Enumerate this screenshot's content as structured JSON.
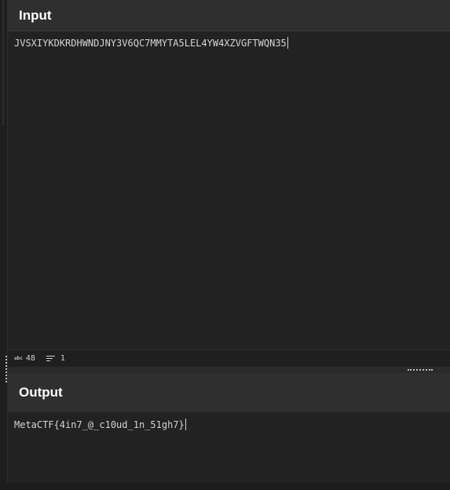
{
  "input": {
    "title": "Input",
    "value": "JVSXIYKDKRDHWNDJNY3V6QC7MMYTA5LEL4YW4XZVGFTWQN35"
  },
  "status": {
    "abc_icon": "abc",
    "char_count": "48",
    "line_icon": "lines-icon",
    "line_count": "1"
  },
  "output": {
    "title": "Output",
    "value": "MetaCTF{4in7_@_c10ud_1n_51gh7}"
  },
  "colors": {
    "background": "#222222",
    "header": "#2f2f2f",
    "text": "#d4d4d4"
  }
}
